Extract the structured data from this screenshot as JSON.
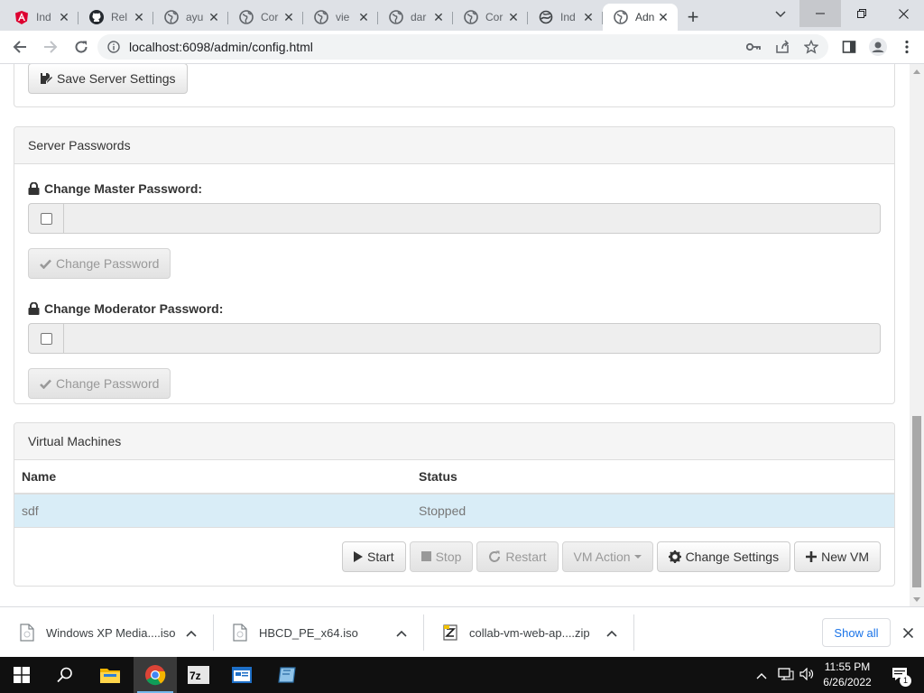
{
  "browser": {
    "tabs": [
      {
        "title": "Ind",
        "icon": "angular-icon"
      },
      {
        "title": "Rel",
        "icon": "github-icon"
      },
      {
        "title": "ayu",
        "icon": "globe-icon"
      },
      {
        "title": "Cor",
        "icon": "globe-icon"
      },
      {
        "title": "vie",
        "icon": "globe-icon"
      },
      {
        "title": "dar",
        "icon": "globe-icon"
      },
      {
        "title": "Cor",
        "icon": "globe-icon"
      },
      {
        "title": "Ind",
        "icon": "swirl-icon"
      },
      {
        "title": "Adn",
        "icon": "globe-icon",
        "active": true
      }
    ],
    "url": "localhost:6098/admin/config.html"
  },
  "page": {
    "save_server_settings": "Save Server Settings",
    "passwords_panel": {
      "title": "Server Passwords",
      "master_label": "Change Master Password:",
      "moderator_label": "Change Moderator Password:",
      "change_button": "Change Password"
    },
    "vm_panel": {
      "title": "Virtual Machines",
      "columns": [
        "Name",
        "Status"
      ],
      "rows": [
        {
          "name": "sdf",
          "status": "Stopped"
        }
      ],
      "actions": {
        "start": "Start",
        "stop": "Stop",
        "restart": "Restart",
        "vm_action": "VM Action",
        "change_settings": "Change Settings",
        "new_vm": "New VM"
      }
    }
  },
  "downloads": {
    "items": [
      {
        "name": "Windows XP Media....iso"
      },
      {
        "name": "HBCD_PE_x64.iso"
      },
      {
        "name": "collab-vm-web-ap....zip"
      }
    ],
    "show_all": "Show all"
  },
  "taskbar": {
    "time": "11:55 PM",
    "date": "6/26/2022",
    "notification_count": "1"
  },
  "colors": {
    "selected_row": "#d9edf7",
    "chrome_tabstrip": "#dee1e6",
    "taskbar": "#101010"
  }
}
